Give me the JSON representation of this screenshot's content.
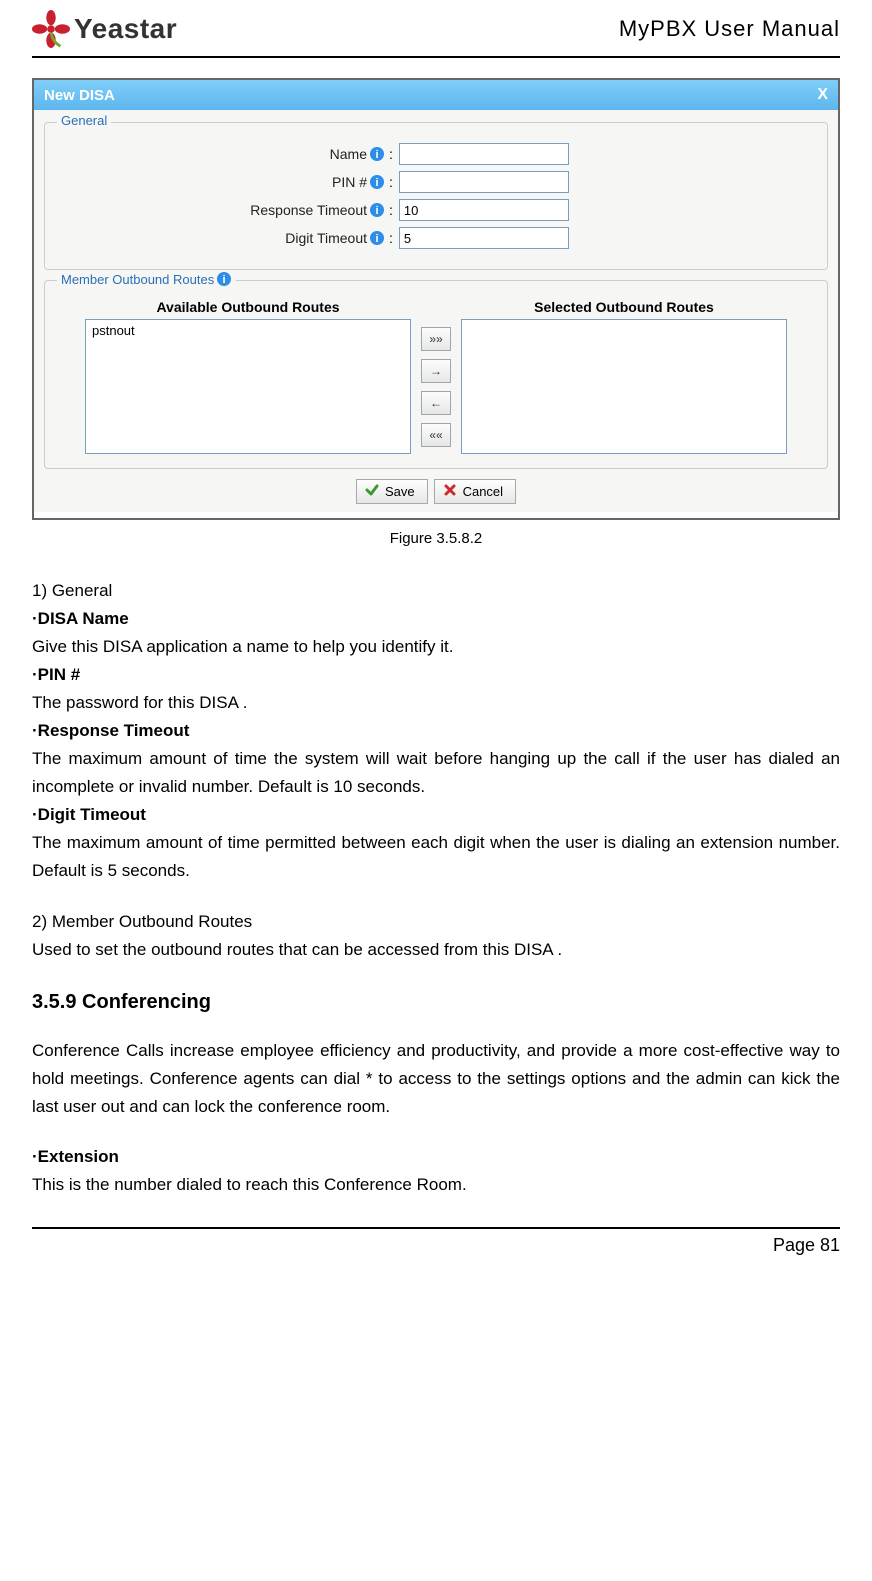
{
  "header": {
    "logo_text": "Yeastar",
    "manual_title": "MyPBX User Manual"
  },
  "dialog": {
    "title": "New DISA",
    "close_glyph": "X",
    "general": {
      "legend": "General",
      "name_label": "Name",
      "name_value": "",
      "pin_label": "PIN #",
      "pin_value": "",
      "response_label": "Response Timeout",
      "response_value": "10",
      "digit_label": "Digit Timeout",
      "digit_value": "5"
    },
    "routes": {
      "legend": "Member Outbound Routes",
      "available_header": "Available Outbound Routes",
      "selected_header": "Selected Outbound Routes",
      "available_items": [
        "pstnout"
      ],
      "btn_all_right": "»»",
      "btn_right": "→",
      "btn_left": "←",
      "btn_all_left": "««"
    },
    "actions": {
      "save": "Save",
      "cancel": "Cancel"
    }
  },
  "figure_caption": "Figure 3.5.8.2",
  "body": {
    "s1_title": "1) General",
    "disa_name_h": "·DISA Name",
    "disa_name_t": "Give this DISA application a name to help you identify it.",
    "pin_h": "·PIN #",
    "pin_t": "The password for this DISA .",
    "resp_h": "·Response Timeout",
    "resp_t": "The maximum amount of time the system will wait before hanging up the call if the user has dialed an incomplete or invalid number. Default is 10 seconds.",
    "digit_h": "·Digit Timeout",
    "digit_t": "The maximum amount of time permitted between each digit when the user is dialing an extension number. Default is 5 seconds.",
    "s2_title": "2) Member Outbound Routes",
    "s2_t": "Used to set the outbound routes that can be accessed from this DISA .",
    "conf_h": "3.5.9 Conferencing",
    "conf_t": "Conference Calls increase employee efficiency and productivity, and provide a more cost-effective way to hold meetings. Conference agents can dial * to access to the settings options and the admin can kick the last user out and can lock the conference room.",
    "ext_h": "·Extension",
    "ext_t": "This is the number dialed to reach this Conference Room."
  },
  "footer": {
    "page": "Page 81"
  }
}
